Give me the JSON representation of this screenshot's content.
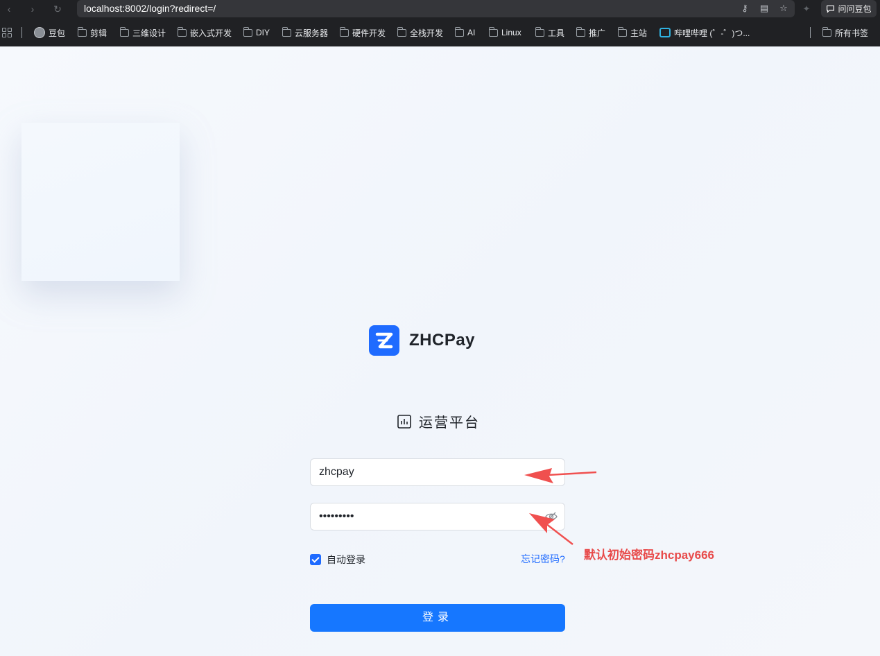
{
  "browser": {
    "url": "localhost:8002/login?redirect=/",
    "ask_label": "问问豆包",
    "bookmarks": [
      {
        "label": "豆包",
        "icon": "avatar-icon"
      },
      {
        "label": "剪辑",
        "icon": "folder-icon"
      },
      {
        "label": "三维设计",
        "icon": "folder-icon"
      },
      {
        "label": "嵌入式开发",
        "icon": "folder-icon"
      },
      {
        "label": "DIY",
        "icon": "folder-icon"
      },
      {
        "label": "云服务器",
        "icon": "folder-icon"
      },
      {
        "label": "硬件开发",
        "icon": "folder-icon"
      },
      {
        "label": "全栈开发",
        "icon": "folder-icon"
      },
      {
        "label": "AI",
        "icon": "folder-icon"
      },
      {
        "label": "Linux",
        "icon": "folder-icon"
      },
      {
        "label": "工具",
        "icon": "folder-icon"
      },
      {
        "label": "推广",
        "icon": "folder-icon"
      },
      {
        "label": "主站",
        "icon": "folder-icon"
      },
      {
        "label": "哔哩哔哩 (゜-゜)つ...",
        "icon": "bilibili-icon"
      },
      {
        "label": "所有书签",
        "icon": "folder-icon"
      }
    ]
  },
  "login": {
    "brand": "ZHCPay",
    "platform_title": "运营平台",
    "username_value": "zhcpay",
    "password_value": "•••••••••",
    "remember_label": "自动登录",
    "remember_checked": true,
    "forgot_label": "忘记密码?",
    "submit_label": "登录"
  },
  "annotation": {
    "text": "默认初始密码zhcpay666",
    "color": "#e84a4a"
  },
  "colors": {
    "primary": "#1677ff",
    "brand": "#1f6bff"
  }
}
